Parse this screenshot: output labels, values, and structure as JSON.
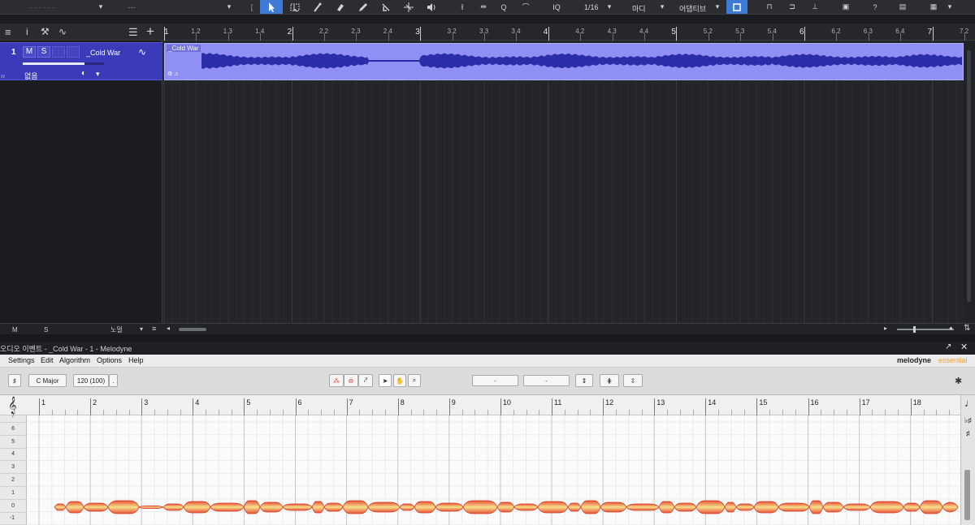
{
  "toolbar": {
    "quantize_value": "1/16",
    "quantize_label": "IQ",
    "timebase": "마디",
    "snap": "어댑티브"
  },
  "track": {
    "number": "1",
    "mute": "M",
    "solo": "S",
    "name": "_Cold War",
    "input": "없음"
  },
  "ruler": {
    "labels": [
      "1",
      "1.2",
      "1.3",
      "1.4",
      "2",
      "2.2",
      "2.3",
      "2.4",
      "3",
      "3.2",
      "3.3",
      "3.4",
      "4",
      "4.2",
      "4.3",
      "4.4",
      "5",
      "5.2",
      "5.3",
      "5.4",
      "6",
      "6.2",
      "6.3",
      "6.4",
      "7",
      "7.2"
    ]
  },
  "clip": {
    "name": "_Cold War"
  },
  "arrange_footer": {
    "m_label": "M",
    "s_label": "S",
    "layer_label": "노멀"
  },
  "editor": {
    "title": "오디오 이벤트 - _Cold War - 1 - Melodyne",
    "menus": [
      "Settings",
      "Edit",
      "Algorithm",
      "Options",
      "Help"
    ],
    "brand": "melodyne",
    "brand_suffix": "essential",
    "scale": "C Major",
    "tempo": "120 (100)",
    "field1": "-",
    "field2": "-",
    "bars": [
      "1",
      "2",
      "3",
      "4",
      "5",
      "6",
      "7",
      "8",
      "9",
      "10",
      "11",
      "12",
      "13",
      "14",
      "15",
      "16",
      "17",
      "18"
    ],
    "pitch_labels": [
      "7",
      "6",
      "5",
      "4",
      "3",
      "2",
      "1",
      "0",
      "-1"
    ]
  },
  "colors": {
    "accent": "#3d7bd6",
    "track": "#3b3ab8",
    "clip": "#8f8ff4",
    "wave": "#2a2ca8",
    "blob": "#e8523a"
  },
  "icons": [
    "pointer-icon",
    "range-icon",
    "split-icon",
    "eraser-icon",
    "pencil-icon",
    "mute-tool-icon",
    "bend-icon",
    "listen-icon",
    "help-icon",
    "grid-icon",
    "settings-icon"
  ]
}
